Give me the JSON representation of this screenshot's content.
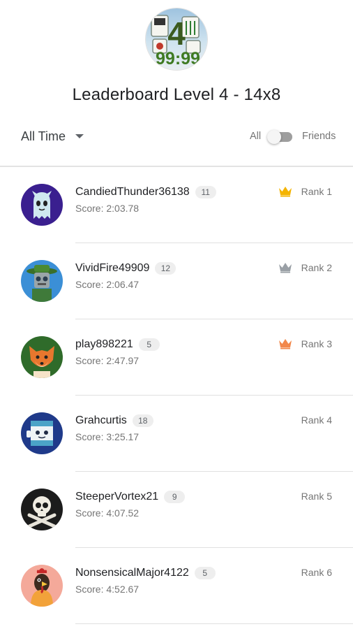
{
  "header": {
    "game_icon": "mahjong-tile-stack-icon",
    "game_icon_number": "4",
    "game_icon_time": "99:99",
    "title": "Leaderboard Level 4 - 14x8",
    "time_filter": "All Time",
    "scope_left_label": "All",
    "scope_right_label": "Friends",
    "friends_only": false
  },
  "colors": {
    "gold_crown": "#f4b400",
    "silver_crown": "#9aa0a6",
    "bronze_crown": "#f2884b",
    "text_primary": "#202124",
    "text_secondary": "#757575"
  },
  "entries": [
    {
      "name": "CandiedThunder36138",
      "level": "11",
      "score": "Score: 2:03.78",
      "rank": "Rank 1",
      "crown": "gold",
      "avatar": "ghost-avatar-icon"
    },
    {
      "name": "VividFire49909",
      "level": "12",
      "score": "Score: 2:06.47",
      "rank": "Rank 2",
      "crown": "silver",
      "avatar": "robot-explorer-avatar-icon"
    },
    {
      "name": "play898221",
      "level": "5",
      "score": "Score: 2:47.97",
      "rank": "Rank 3",
      "crown": "bronze",
      "avatar": "fox-avatar-icon"
    },
    {
      "name": "Grahcurtis",
      "level": "18",
      "score": "Score: 3:25.17",
      "rank": "Rank 4",
      "crown": "none",
      "avatar": "robot-avatar-icon"
    },
    {
      "name": "SteeperVortex21",
      "level": "9",
      "score": "Score: 4:07.52",
      "rank": "Rank 5",
      "crown": "none",
      "avatar": "skull-crossbones-avatar-icon"
    },
    {
      "name": "NonsensicalMajor4122",
      "level": "5",
      "score": "Score: 4:52.67",
      "rank": "Rank 6",
      "crown": "none",
      "avatar": "rooster-avatar-icon"
    }
  ]
}
